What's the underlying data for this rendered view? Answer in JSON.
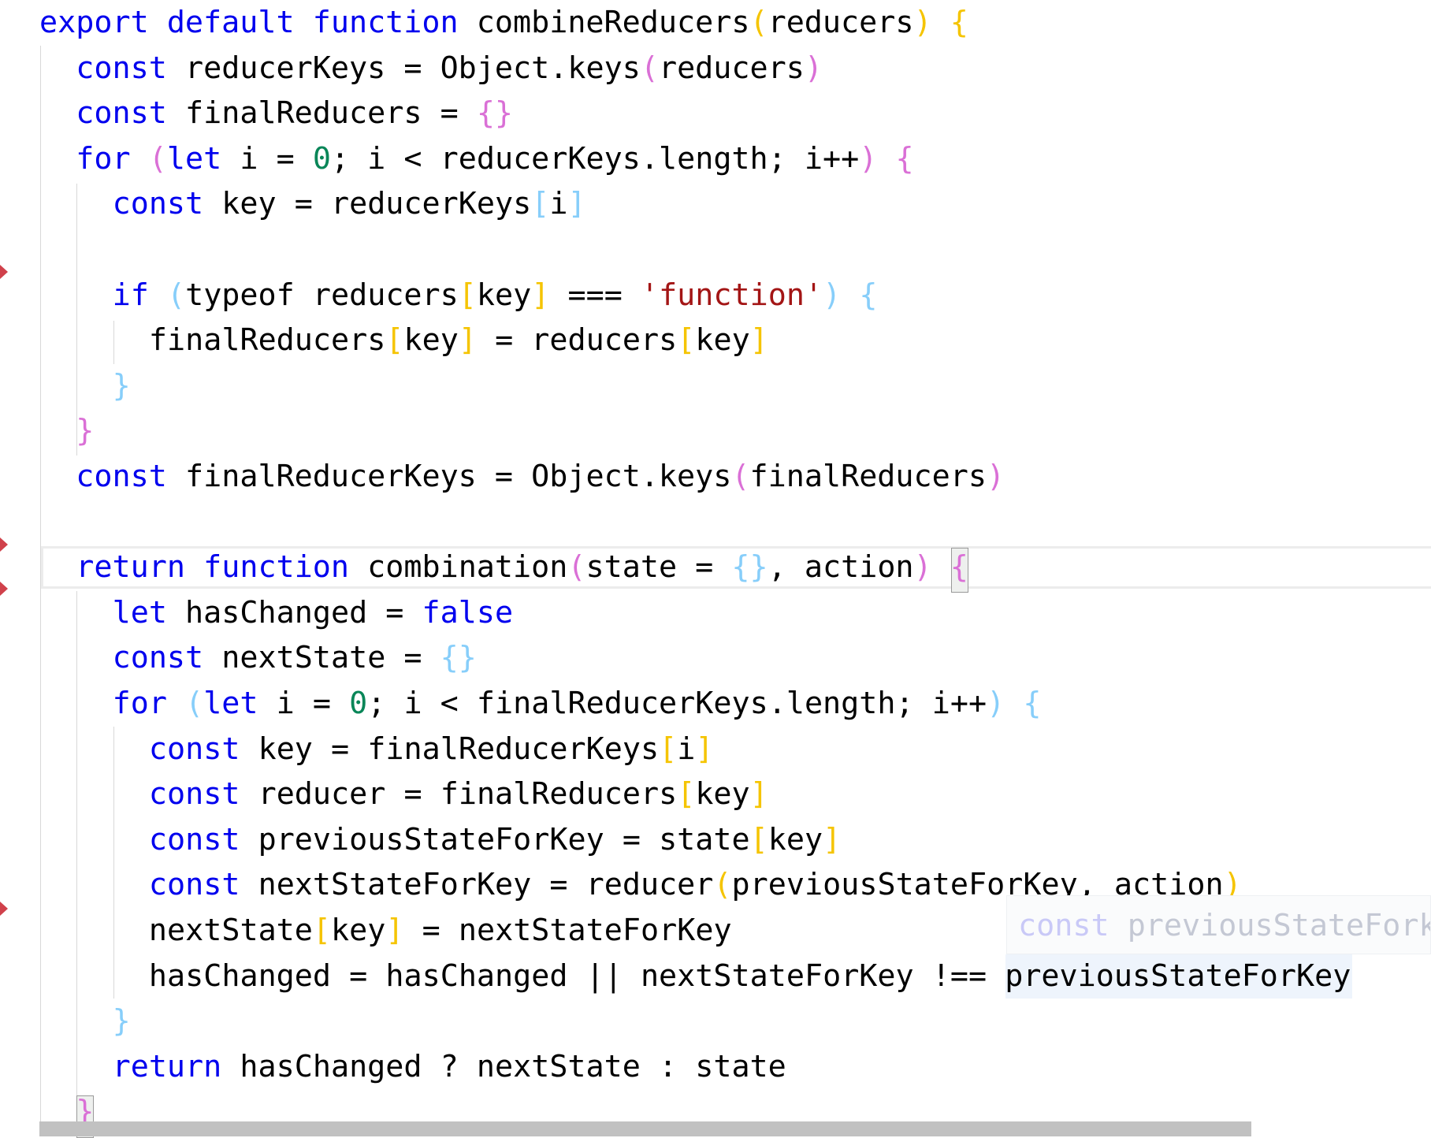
{
  "code": {
    "lines": [
      {
        "indent": 0,
        "tokens": [
          [
            "export",
            "kw"
          ],
          [
            " ",
            ""
          ],
          [
            "default",
            "kw"
          ],
          [
            " ",
            ""
          ],
          [
            "function",
            "kw"
          ],
          [
            " combineReducers",
            ""
          ],
          [
            "(",
            "gold"
          ],
          [
            "reducers",
            ""
          ],
          [
            ")",
            "gold"
          ],
          [
            " ",
            ""
          ],
          [
            "{",
            "gold"
          ]
        ]
      },
      {
        "indent": 1,
        "tokens": [
          [
            "const",
            "kw"
          ],
          [
            " reducerKeys = Object.keys",
            ""
          ],
          [
            "(",
            "orchid"
          ],
          [
            "reducers",
            ""
          ],
          [
            ")",
            "orchid"
          ]
        ]
      },
      {
        "indent": 1,
        "tokens": [
          [
            "const",
            "kw"
          ],
          [
            " finalReducers = ",
            ""
          ],
          [
            "{}",
            "orchid"
          ]
        ]
      },
      {
        "indent": 1,
        "tokens": [
          [
            "for",
            "kw"
          ],
          [
            " ",
            ""
          ],
          [
            "(",
            "orchid"
          ],
          [
            "let",
            "kw"
          ],
          [
            " i = ",
            ""
          ],
          [
            "0",
            "num"
          ],
          [
            "; i < reducerKeys.length; i++",
            ""
          ],
          [
            ")",
            "orchid"
          ],
          [
            " ",
            ""
          ],
          [
            "{",
            "orchid"
          ]
        ]
      },
      {
        "indent": 2,
        "tokens": [
          [
            "const",
            "kw"
          ],
          [
            " key = reducerKeys",
            ""
          ],
          [
            "[",
            "lb"
          ],
          [
            "i",
            ""
          ],
          [
            "]",
            "lb"
          ]
        ]
      },
      {
        "indent": 2,
        "tokens": []
      },
      {
        "indent": 2,
        "tokens": [
          [
            "if",
            "kw"
          ],
          [
            " ",
            ""
          ],
          [
            "(",
            "lb"
          ],
          [
            "typeof reducers",
            ""
          ],
          [
            "[",
            "gold"
          ],
          [
            "key",
            ""
          ],
          [
            "]",
            "gold"
          ],
          [
            " === ",
            ""
          ],
          [
            "'function'",
            "str"
          ],
          [
            ")",
            "lb"
          ],
          [
            " ",
            ""
          ],
          [
            "{",
            "lb"
          ]
        ]
      },
      {
        "indent": 3,
        "tokens": [
          [
            "finalReducers",
            ""
          ],
          [
            "[",
            "gold"
          ],
          [
            "key",
            ""
          ],
          [
            "]",
            "gold"
          ],
          [
            " = reducers",
            ""
          ],
          [
            "[",
            "gold"
          ],
          [
            "key",
            ""
          ],
          [
            "]",
            "gold"
          ]
        ]
      },
      {
        "indent": 2,
        "tokens": [
          [
            "}",
            "lb"
          ]
        ]
      },
      {
        "indent": 1,
        "tokens": [
          [
            "}",
            "orchid"
          ]
        ]
      },
      {
        "indent": 1,
        "tokens": [
          [
            "const",
            "kw"
          ],
          [
            " finalReducerKeys = Object.keys",
            ""
          ],
          [
            "(",
            "orchid"
          ],
          [
            "finalReducers",
            ""
          ],
          [
            ")",
            "orchid"
          ]
        ]
      },
      {
        "indent": 1,
        "tokens": []
      },
      {
        "indent": 1,
        "tokens": [
          [
            "return",
            "kw"
          ],
          [
            " ",
            ""
          ],
          [
            "function",
            "kw"
          ],
          [
            " combination",
            ""
          ],
          [
            "(",
            "orchid"
          ],
          [
            "state = ",
            ""
          ],
          [
            "{}",
            "lb"
          ],
          [
            ", action",
            ""
          ],
          [
            ")",
            "orchid"
          ],
          [
            " ",
            ""
          ],
          [
            "{",
            "orchid"
          ]
        ]
      },
      {
        "indent": 2,
        "tokens": [
          [
            "let",
            "kw"
          ],
          [
            " hasChanged = ",
            ""
          ],
          [
            "false",
            "kw"
          ]
        ]
      },
      {
        "indent": 2,
        "tokens": [
          [
            "const",
            "kw"
          ],
          [
            " nextState = ",
            ""
          ],
          [
            "{}",
            "lb"
          ]
        ]
      },
      {
        "indent": 2,
        "tokens": [
          [
            "for",
            "kw"
          ],
          [
            " ",
            ""
          ],
          [
            "(",
            "lb"
          ],
          [
            "let",
            "kw"
          ],
          [
            " i = ",
            ""
          ],
          [
            "0",
            "num"
          ],
          [
            "; i < finalReducerKeys.length; i++",
            ""
          ],
          [
            ")",
            "lb"
          ],
          [
            " ",
            ""
          ],
          [
            "{",
            "lb"
          ]
        ]
      },
      {
        "indent": 3,
        "tokens": [
          [
            "const",
            "kw"
          ],
          [
            " key = finalReducerKeys",
            ""
          ],
          [
            "[",
            "gold"
          ],
          [
            "i",
            ""
          ],
          [
            "]",
            "gold"
          ]
        ]
      },
      {
        "indent": 3,
        "tokens": [
          [
            "const",
            "kw"
          ],
          [
            " reducer = finalReducers",
            ""
          ],
          [
            "[",
            "gold"
          ],
          [
            "key",
            ""
          ],
          [
            "]",
            "gold"
          ]
        ]
      },
      {
        "indent": 3,
        "tokens": [
          [
            "const",
            "kw"
          ],
          [
            " previousStateForKey = state",
            ""
          ],
          [
            "[",
            "gold"
          ],
          [
            "key",
            ""
          ],
          [
            "]",
            "gold"
          ]
        ]
      },
      {
        "indent": 3,
        "tokens": [
          [
            "const",
            "kw"
          ],
          [
            " nextStateForKey = reducer",
            ""
          ],
          [
            "(",
            "gold"
          ],
          [
            "previousStateForKey, action",
            ""
          ],
          [
            ")",
            "gold"
          ]
        ]
      },
      {
        "indent": 3,
        "tokens": [
          [
            "nextState",
            ""
          ],
          [
            "[",
            "gold"
          ],
          [
            "key",
            ""
          ],
          [
            "]",
            "gold"
          ],
          [
            " = nextStateForKey",
            ""
          ]
        ]
      },
      {
        "indent": 3,
        "tokens": [
          [
            "hasChanged = hasChanged || nextStateForKey !== previousStateForKey",
            ""
          ]
        ]
      },
      {
        "indent": 2,
        "tokens": [
          [
            "}",
            "lb"
          ]
        ]
      },
      {
        "indent": 2,
        "tokens": [
          [
            "return",
            "kw"
          ],
          [
            " hasChanged ? nextState : state",
            ""
          ]
        ]
      },
      {
        "indent": 1,
        "tokens": [
          [
            "}",
            "orchid"
          ]
        ]
      }
    ]
  },
  "tooltip": {
    "keyword": "const",
    "text": " previousStateFork"
  },
  "colors": {
    "keyword": "#0000ee",
    "string": "#a31515",
    "number": "#098658",
    "bracket_gold": "#f5c400",
    "bracket_orchid": "#da70d6",
    "bracket_lightblue": "#87cefa",
    "marker": "#d0414b"
  }
}
